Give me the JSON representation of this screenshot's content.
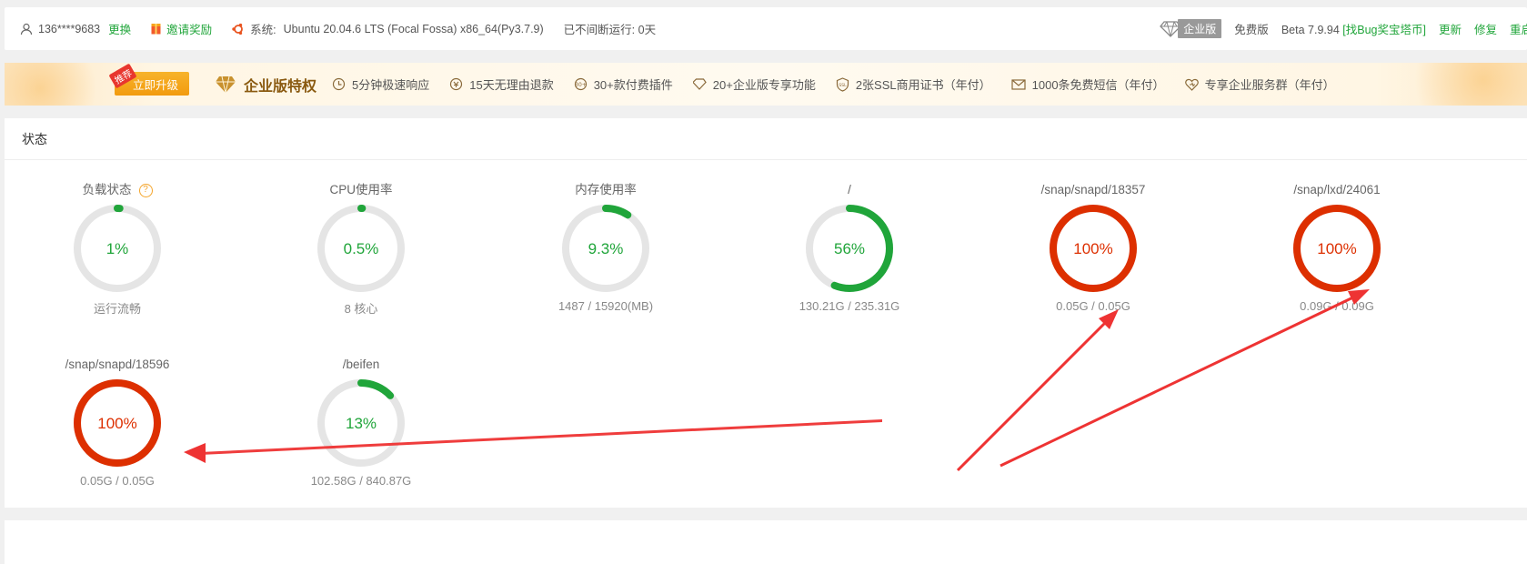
{
  "topbar": {
    "account": "136****9683",
    "change_label": "更换",
    "invite_label": "邀请奖励",
    "system_label": "系统:",
    "system_value": "Ubuntu 20.04.6 LTS (Focal Fossa) x86_64(Py3.7.9)",
    "uptime": "已不间断运行: 0天",
    "enterprise_tag": "企业版",
    "free_label": "免费版",
    "beta_label": "Beta",
    "version": "7.9.94",
    "bug_bounty": "[找Bug奖宝塔币]",
    "update_label": "更新",
    "repair_label": "修复",
    "restart_label": "重启"
  },
  "banner": {
    "recommend_tag": "推荐",
    "upgrade_button": "立即升级",
    "title": "企业版特权",
    "perks": [
      {
        "icon": "clock-icon",
        "label": "5分钟极速响应"
      },
      {
        "icon": "refund-icon",
        "label": "15天无理由退款"
      },
      {
        "icon": "plugin-icon",
        "label": "30+款付费插件"
      },
      {
        "icon": "diamond-icon",
        "label": "20+企业版专享功能"
      },
      {
        "icon": "ssl-shield-icon",
        "label": "2张SSL商用证书（年付）"
      },
      {
        "icon": "mail-icon",
        "label": "1000条免费短信（年付）"
      },
      {
        "icon": "heart-service-icon",
        "label": "专享企业服务群（年付）"
      }
    ]
  },
  "status": {
    "title": "状态",
    "gauges": [
      {
        "title": "负载状态",
        "value": "1%",
        "percent": 1,
        "subtitle": "运行流畅",
        "color": "#20a53a",
        "help": true
      },
      {
        "title": "CPU使用率",
        "value": "0.5%",
        "percent": 0.5,
        "subtitle": "8 核心",
        "color": "#20a53a"
      },
      {
        "title": "内存使用率",
        "value": "9.3%",
        "percent": 9.3,
        "subtitle": "1487 / 15920(MB)",
        "color": "#20a53a"
      },
      {
        "title": "/",
        "value": "56%",
        "percent": 56,
        "subtitle": "130.21G / 235.31G",
        "color": "#20a53a"
      },
      {
        "title": "/snap/snapd/18357",
        "value": "100%",
        "percent": 100,
        "subtitle": "0.05G / 0.05G",
        "color": "#dd2f00"
      },
      {
        "title": "/snap/lxd/24061",
        "value": "100%",
        "percent": 100,
        "subtitle": "0.09G / 0.09G",
        "color": "#dd2f00"
      },
      {
        "title": "/snap/snapd/18596",
        "value": "100%",
        "percent": 100,
        "subtitle": "0.05G / 0.05G",
        "color": "#dd2f00"
      },
      {
        "title": "/beifen",
        "value": "13%",
        "percent": 13,
        "subtitle": "102.58G / 840.87G",
        "color": "#20a53a"
      }
    ]
  },
  "colors": {
    "green": "#20a53a",
    "red": "#dd2f00",
    "track": "#e5e5e5",
    "annotation_arrow": "#ee3333"
  }
}
